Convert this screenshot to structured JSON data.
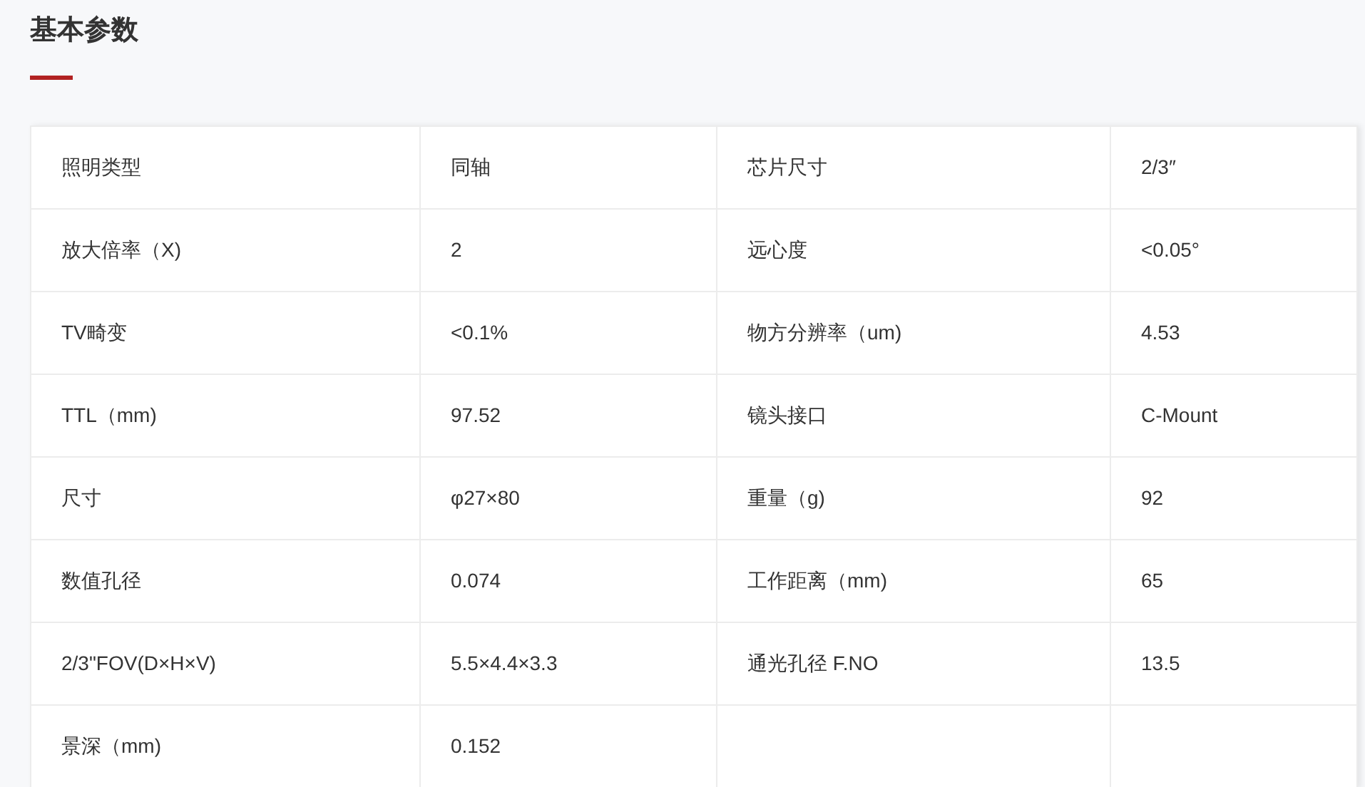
{
  "title": "基本参数",
  "table": {
    "rows": [
      {
        "cells": [
          "照明类型",
          "同轴",
          "芯片尺寸",
          "2/3″"
        ]
      },
      {
        "cells": [
          "放大倍率（X)",
          "2",
          "远心度",
          "<0.05°"
        ]
      },
      {
        "cells": [
          "TV畸变",
          "<0.1%",
          "物方分辨率（um)",
          "4.53"
        ]
      },
      {
        "cells": [
          "TTL（mm)",
          "97.52",
          "镜头接口",
          "C-Mount"
        ]
      },
      {
        "cells": [
          "尺寸",
          "φ27×80",
          "重量（g)",
          "92"
        ]
      },
      {
        "cells": [
          "数值孔径",
          "0.074",
          "工作距离（mm)",
          "65"
        ]
      },
      {
        "cells": [
          "2/3\"FOV(D×H×V)",
          "5.5×4.4×3.3",
          "通光孔径 F.NO",
          "13.5"
        ]
      },
      {
        "cells": [
          "景深（mm)",
          "0.152"
        ]
      }
    ]
  }
}
